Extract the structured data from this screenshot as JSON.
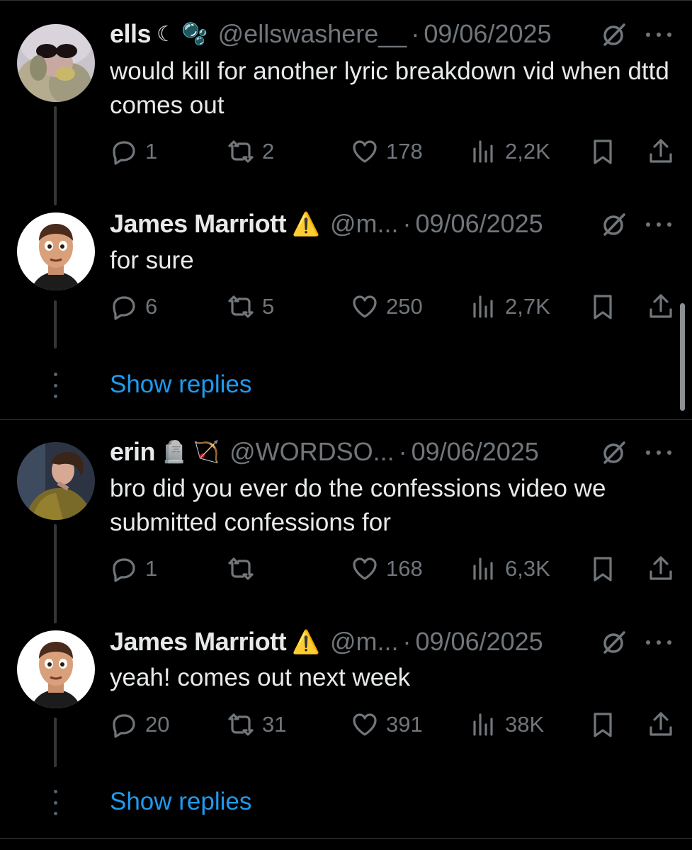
{
  "threads": [
    {
      "tweets": [
        {
          "name": "ells",
          "emoji": "☾ 🫧",
          "handle": "@ellswashere__",
          "date": "09/06/2025",
          "text": "would kill for another lyric breakdown vid when dttd comes out",
          "replies": "1",
          "reposts": "2",
          "likes": "178",
          "views": "2,2K"
        },
        {
          "name": "James Marriott",
          "emoji": "⚠️",
          "handle": "@m...",
          "date": "09/06/2025",
          "text": "for sure",
          "replies": "6",
          "reposts": "5",
          "likes": "250",
          "views": "2,7K"
        }
      ],
      "show_replies": "Show replies"
    },
    {
      "tweets": [
        {
          "name": "erin",
          "emoji": "🪦 🏹",
          "handle": "@WORDSO...",
          "date": "09/06/2025",
          "text": "bro did you ever do the confessions video we submitted confessions for",
          "replies": "1",
          "reposts": "",
          "likes": "168",
          "views": "6,3K"
        },
        {
          "name": "James Marriott",
          "emoji": "⚠️",
          "handle": "@m...",
          "date": "09/06/2025",
          "text": "yeah! comes out next week",
          "replies": "20",
          "reposts": "31",
          "likes": "391",
          "views": "38K"
        }
      ],
      "show_replies": "Show replies"
    }
  ],
  "separator": "·",
  "colors": {
    "background": "#000000",
    "text": "#e7e9ea",
    "secondary": "#71767b",
    "link": "#1d9bf0",
    "divider": "#2f3336"
  }
}
